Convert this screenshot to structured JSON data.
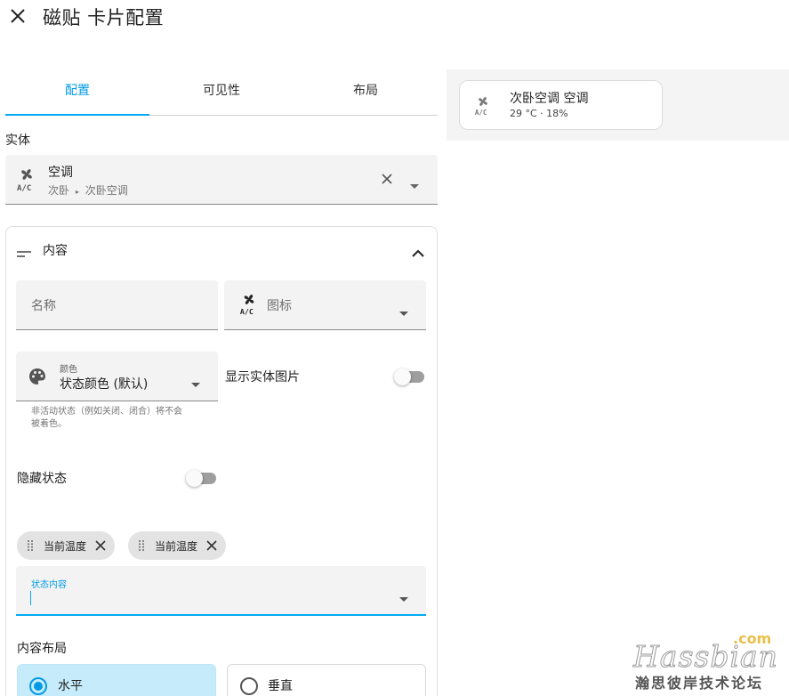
{
  "header": {
    "title": "磁贴 卡片配置"
  },
  "tabs": [
    {
      "label": "配置",
      "active": true
    },
    {
      "label": "可见性",
      "active": false
    },
    {
      "label": "布局",
      "active": false
    }
  ],
  "entity": {
    "section_label": "实体",
    "name": "空调",
    "path_area": "次卧",
    "path_device": "次卧空调",
    "icon": "air-conditioner-icon"
  },
  "content": {
    "title": "内容",
    "name_placeholder": "名称",
    "icon_placeholder": "图标",
    "color_label": "颜色",
    "color_value": "状态颜色 (默认)",
    "color_helper_1": "非活动状态（例如关闭、闭合）将不会",
    "color_helper_2": "被着色。",
    "show_picture_label": "显示实体图片",
    "show_picture_on": false,
    "hide_state_label": "隐藏状态",
    "hide_state_on": false,
    "chips": [
      "当前温度",
      "当前温度"
    ],
    "state_content_label": "状态内容",
    "layout_label": "内容布局",
    "layout_options": [
      {
        "label": "水平",
        "selected": true
      },
      {
        "label": "垂直",
        "selected": false
      }
    ]
  },
  "preview": {
    "name": "次卧空调 空调",
    "state": "29 °C · 18%"
  },
  "colors": {
    "accent": "#03a9f4",
    "field_bg": "#f3f3f3",
    "chip_bg": "#e3e3e3",
    "selected_bg": "#c6ecfb"
  },
  "watermark": {
    "main": "Hassbian",
    "com": ".com",
    "sub": "瀚思彼岸技术论坛"
  }
}
